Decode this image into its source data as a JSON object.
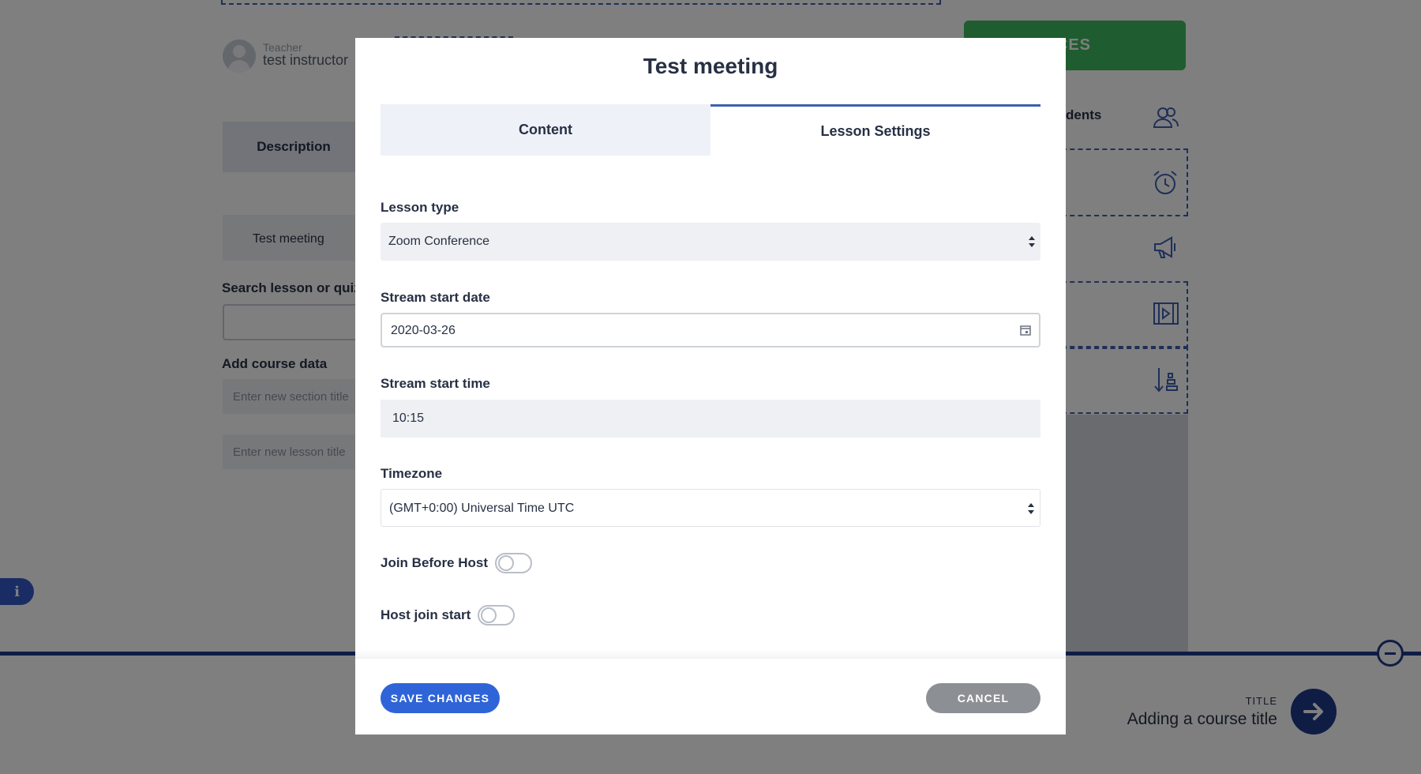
{
  "background": {
    "teacher_label": "Teacher",
    "teacher_name": "test instructor",
    "green_button_label": "CES",
    "description_tab": "Description",
    "students_label": "dents",
    "curriculum_item": "Test meeting",
    "search_label": "Search lesson or quiz",
    "add_course_data_label": "Add course data",
    "section_title_placeholder": "Enter new section title",
    "lesson_title_placeholder": "Enter new lesson title",
    "info_icon": "i",
    "footer_title_label": "TITLE",
    "footer_title": "Adding a course title"
  },
  "modal": {
    "title": "Test meeting",
    "tabs": [
      {
        "label": "Content",
        "active": false
      },
      {
        "label": "Lesson Settings",
        "active": true
      }
    ],
    "lesson_type": {
      "label": "Lesson type",
      "value": "Zoom Conference"
    },
    "stream_start_date": {
      "label": "Stream start date",
      "value": "2020-03-26"
    },
    "stream_start_time": {
      "label": "Stream start time",
      "value": "10:15"
    },
    "timezone": {
      "label": "Timezone",
      "value": "(GMT+0:00) Universal Time UTC"
    },
    "join_before_host": {
      "label": "Join Before Host",
      "enabled": false
    },
    "host_join_start": {
      "label": "Host join start",
      "enabled": false
    },
    "save_label": "SAVE CHANGES",
    "cancel_label": "CANCEL"
  },
  "colors": {
    "accent": "#2f64d8",
    "tab_underline": "#3e5fb3",
    "green": "#3fb85f",
    "navy": "#1f3a8a",
    "cancel_gray": "#8c8f94"
  }
}
